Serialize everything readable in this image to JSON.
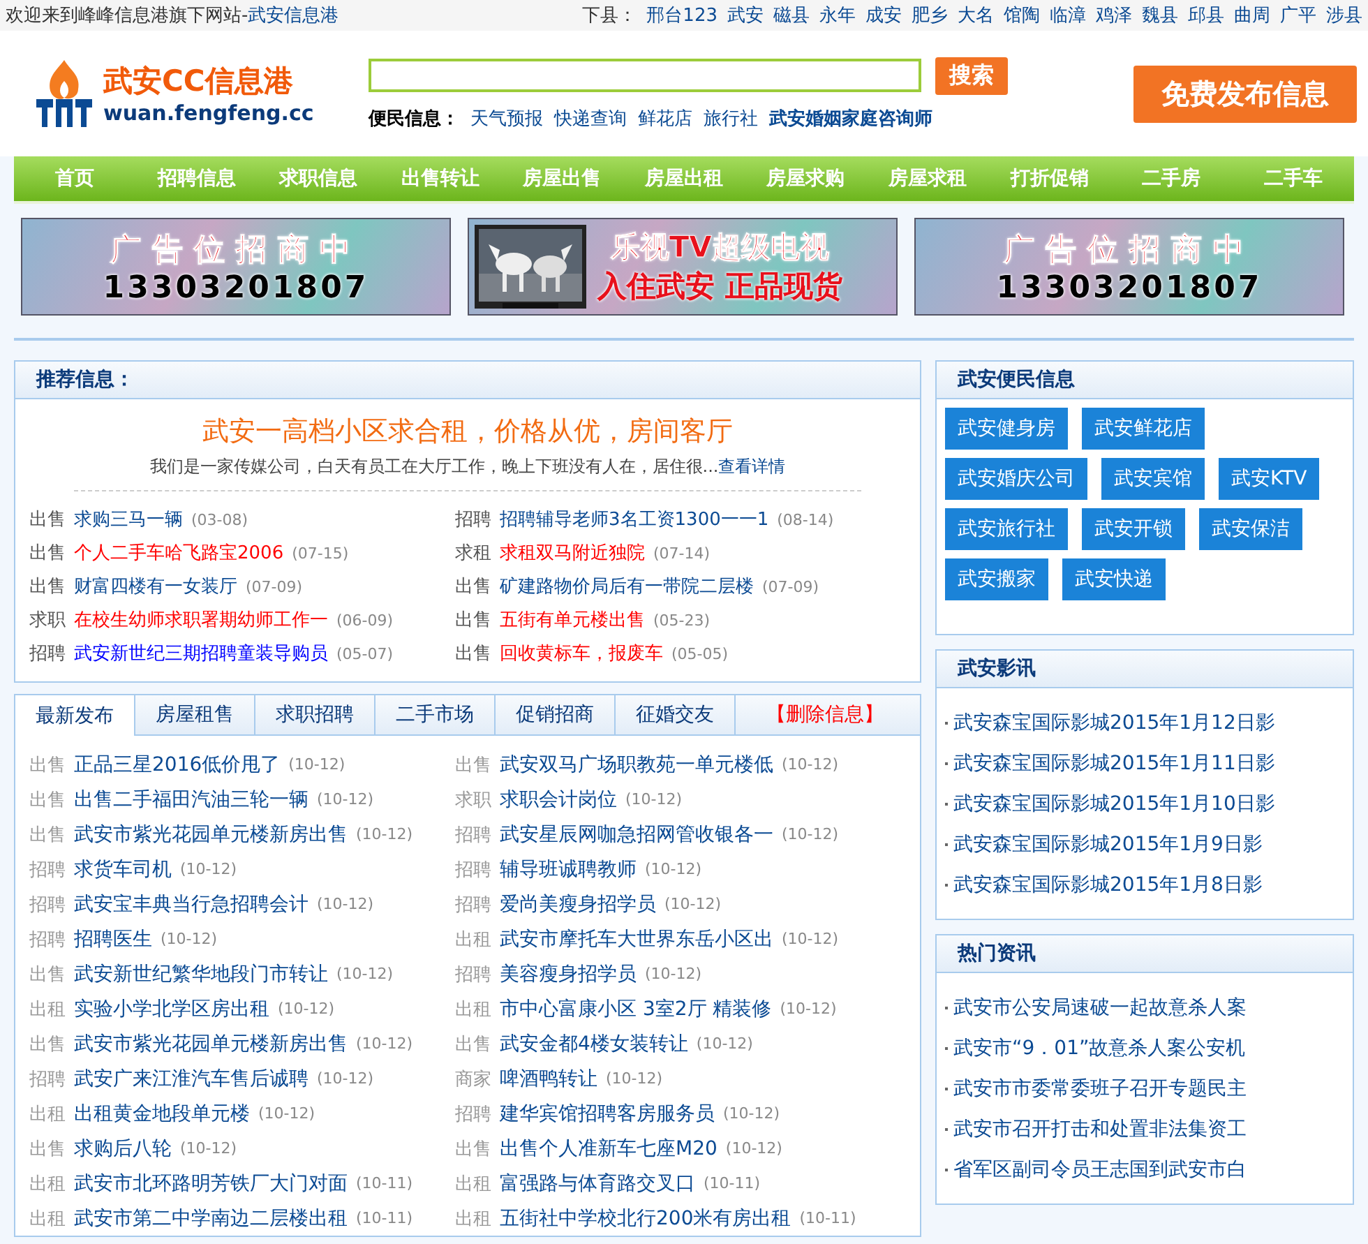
{
  "top_bar": {
    "welcome": "欢迎来到峰峰信息港旗下网站-",
    "site_link": "武安信息港",
    "counties_label": "下县：",
    "counties": [
      "邢台123",
      "武安",
      "磁县",
      "永年",
      "成安",
      "肥乡",
      "大名",
      "馆陶",
      "临漳",
      "鸡泽",
      "魏县",
      "邱县",
      "曲周",
      "广平",
      "涉县"
    ]
  },
  "header": {
    "logo_title": "武安CC信息港",
    "logo_domain": "wuan.fengfeng.cc",
    "search_button": "搜索",
    "service_label": "便民信息：",
    "service_links": [
      {
        "text": "天气预报",
        "bold": false
      },
      {
        "text": "快递查询",
        "bold": false
      },
      {
        "text": "鲜花店",
        "bold": false
      },
      {
        "text": "旅行社",
        "bold": false
      },
      {
        "text": "武安婚姻家庭咨询师",
        "bold": true
      }
    ],
    "publish_button": "免费发布信息"
  },
  "nav": [
    "首页",
    "招聘信息",
    "求职信息",
    "出售转让",
    "房屋出售",
    "房屋出租",
    "房屋求购",
    "房屋求租",
    "打折促销",
    "二手房",
    "二手车"
  ],
  "ads": [
    {
      "kind": "text",
      "lines": [
        "广告位招商中",
        "13303201807"
      ]
    },
    {
      "kind": "picture",
      "lines": [
        "乐视TV超级电视",
        "入住武安 正品现货"
      ]
    },
    {
      "kind": "text",
      "lines": [
        "广告位招商中",
        "13303201807"
      ]
    }
  ],
  "recommend": {
    "title": "推荐信息：",
    "headline": "武安一高档小区求合租，价格从优，房间客厅",
    "summary": "我们是一家传媒公司，白天有员工在大厅工作，晚上下班没有人在，居住很...",
    "more_link": "查看详情",
    "items": [
      {
        "category": "出售",
        "title": "求购三马一辆",
        "date": "(03-08)",
        "color": "#0b4a93"
      },
      {
        "category": "招聘",
        "title": "招聘辅导老师3名工资1300一一1",
        "date": "(08-14)",
        "color": "#0b4a93"
      },
      {
        "category": "出售",
        "title": "个人二手车哈飞路宝2006",
        "date": "(07-15)",
        "color": "#ff0000"
      },
      {
        "category": "求租",
        "title": "求租双马附近独院",
        "date": "(07-14)",
        "color": "#ff0000"
      },
      {
        "category": "出售",
        "title": "财富四楼有一女装厅",
        "date": "(07-09)",
        "color": "#0b4a93"
      },
      {
        "category": "出售",
        "title": "矿建路物价局后有一带院二层楼",
        "date": "(07-09)",
        "color": "#0b4a93"
      },
      {
        "category": "求职",
        "title": "在校生幼师求职署期幼师工作一",
        "date": "(06-09)",
        "color": "#ff0000"
      },
      {
        "category": "出售",
        "title": "五街有单元楼出售",
        "date": "(05-23)",
        "color": "#ff0000"
      },
      {
        "category": "招聘",
        "title": "武安新世纪三期招聘童装导购员",
        "date": "(05-07)",
        "color": "#0000ff"
      },
      {
        "category": "出售",
        "title": "回收黄标车，报废车",
        "date": "(05-05)",
        "color": "#ff0000"
      }
    ]
  },
  "latest": {
    "tabs": [
      {
        "label": "最新发布",
        "selected": true
      },
      {
        "label": "房屋租售",
        "selected": false
      },
      {
        "label": "求职招聘",
        "selected": false
      },
      {
        "label": "二手市场",
        "selected": false
      },
      {
        "label": "促销招商",
        "selected": false
      },
      {
        "label": "征婚交友",
        "selected": false
      }
    ],
    "delete_link": "【删除信息】",
    "items": [
      {
        "category": "出售",
        "title": "正品三星2016低价甩了",
        "date": "(10-12)"
      },
      {
        "category": "出售",
        "title": "武安双马广场职教苑一单元楼低",
        "date": "(10-12)"
      },
      {
        "category": "出售",
        "title": "出售二手福田汽油三轮一辆",
        "date": "(10-12)"
      },
      {
        "category": "求职",
        "title": "求职会计岗位",
        "date": "(10-12)"
      },
      {
        "category": "出售",
        "title": "武安市紫光花园单元楼新房出售",
        "date": "(10-12)"
      },
      {
        "category": "招聘",
        "title": "武安星辰网咖急招网管收银各一",
        "date": "(10-12)"
      },
      {
        "category": "招聘",
        "title": "求货车司机",
        "date": "(10-12)"
      },
      {
        "category": "招聘",
        "title": "辅导班诚聘教师",
        "date": "(10-12)"
      },
      {
        "category": "招聘",
        "title": "武安宝丰典当行急招聘会计",
        "date": "(10-12)"
      },
      {
        "category": "招聘",
        "title": "爱尚美瘦身招学员",
        "date": "(10-12)"
      },
      {
        "category": "招聘",
        "title": "招聘医生",
        "date": "(10-12)"
      },
      {
        "category": "出租",
        "title": "武安市摩托车大世界东岳小区出",
        "date": "(10-12)"
      },
      {
        "category": "出售",
        "title": "武安新世纪繁华地段门市转让",
        "date": "(10-12)"
      },
      {
        "category": "招聘",
        "title": "美容瘦身招学员",
        "date": "(10-12)"
      },
      {
        "category": "出租",
        "title": "实验小学北学区房出租",
        "date": "(10-12)"
      },
      {
        "category": "出租",
        "title": "市中心富康小区 3室2厅 精装修",
        "date": "(10-12)"
      },
      {
        "category": "出售",
        "title": "武安市紫光花园单元楼新房出售",
        "date": "(10-12)"
      },
      {
        "category": "出售",
        "title": "武安金都4楼女装转让",
        "date": "(10-12)"
      },
      {
        "category": "招聘",
        "title": "武安广来江淮汽车售后诚聘",
        "date": "(10-12)"
      },
      {
        "category": "商家",
        "title": "啤酒鸭转让",
        "date": "(10-12)"
      },
      {
        "category": "出租",
        "title": "出租黄金地段单元楼",
        "date": "(10-12)"
      },
      {
        "category": "招聘",
        "title": "建华宾馆招聘客房服务员",
        "date": "(10-12)"
      },
      {
        "category": "出售",
        "title": "求购后八轮",
        "date": "(10-12)"
      },
      {
        "category": "出售",
        "title": "出售个人准新车七座M20",
        "date": "(10-12)"
      },
      {
        "category": "出租",
        "title": "武安市北环路明芳铁厂大门对面",
        "date": "(10-11)"
      },
      {
        "category": "出租",
        "title": "富强路与体育路交叉口",
        "date": "(10-11)"
      },
      {
        "category": "出租",
        "title": "武安市第二中学南边二层楼出租",
        "date": "(10-11)"
      },
      {
        "category": "出租",
        "title": "五街社中学校北行200米有房出租",
        "date": "(10-11)"
      }
    ]
  },
  "sidebar": {
    "services": {
      "title": "武安便民信息",
      "items": [
        "武安健身房",
        "武安鲜花店",
        "武安婚庆公司",
        "武安宾馆",
        "武安KTV",
        "武安旅行社",
        "武安开锁",
        "武安保洁",
        "武安搬家",
        "武安快递"
      ]
    },
    "movies": {
      "title": "武安影讯",
      "items": [
        "武安森宝国际影城2015年1月12日影",
        "武安森宝国际影城2015年1月11日影",
        "武安森宝国际影城2015年1月10日影",
        "武安森宝国际影城2015年1月9日影",
        "武安森宝国际影城2015年1月8日影"
      ]
    },
    "hot_news": {
      "title": "热门资讯",
      "items": [
        "武安市公安局速破一起故意杀人案",
        "武安市“9．01”故意杀人案公安机",
        "武安市市委常委班子召开专题民主",
        "武安市召开打击和处置非法集资工",
        "省军区副司令员王志国到武安市白"
      ]
    }
  }
}
